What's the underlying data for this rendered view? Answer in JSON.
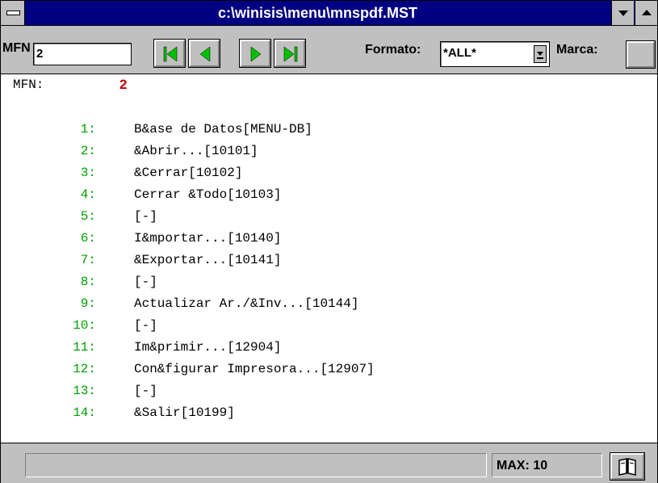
{
  "window": {
    "title": "c:\\winisis\\menu\\mnspdf.MST"
  },
  "toolbar": {
    "mfn_label": "MFN",
    "mfn_value": "2",
    "format_label": "Formato:",
    "format_value": "*ALL*",
    "marca_label": "Marca:"
  },
  "record": {
    "mfn_label": "MFN:",
    "mfn_value": "2",
    "fields": [
      {
        "num": "1:",
        "text": "B&ase de Datos[MENU-DB]"
      },
      {
        "num": "2:",
        "text": "&Abrir...[10101]"
      },
      {
        "num": "3:",
        "text": "&Cerrar[10102]"
      },
      {
        "num": "4:",
        "text": "Cerrar &Todo[10103]"
      },
      {
        "num": "5:",
        "text": "[-]"
      },
      {
        "num": "6:",
        "text": "I&mportar...[10140]"
      },
      {
        "num": "7:",
        "text": "&Exportar...[10141]"
      },
      {
        "num": "8:",
        "text": "[-]"
      },
      {
        "num": "9:",
        "text": "Actualizar Ar./&Inv...[10144]"
      },
      {
        "num": "10:",
        "text": "[-]"
      },
      {
        "num": "11:",
        "text": "Im&primir...[12904]"
      },
      {
        "num": "12:",
        "text": "Con&figurar Impresora...[12907]"
      },
      {
        "num": "13:",
        "text": "[-]"
      },
      {
        "num": "14:",
        "text": "&Salir[10199]"
      }
    ]
  },
  "status": {
    "message": "",
    "max_text": "MAX: 10"
  },
  "colors": {
    "title_bar": "#000080",
    "field_number": "#00a000",
    "mfn_value": "#c00000",
    "chrome": "#c0c0c0"
  }
}
